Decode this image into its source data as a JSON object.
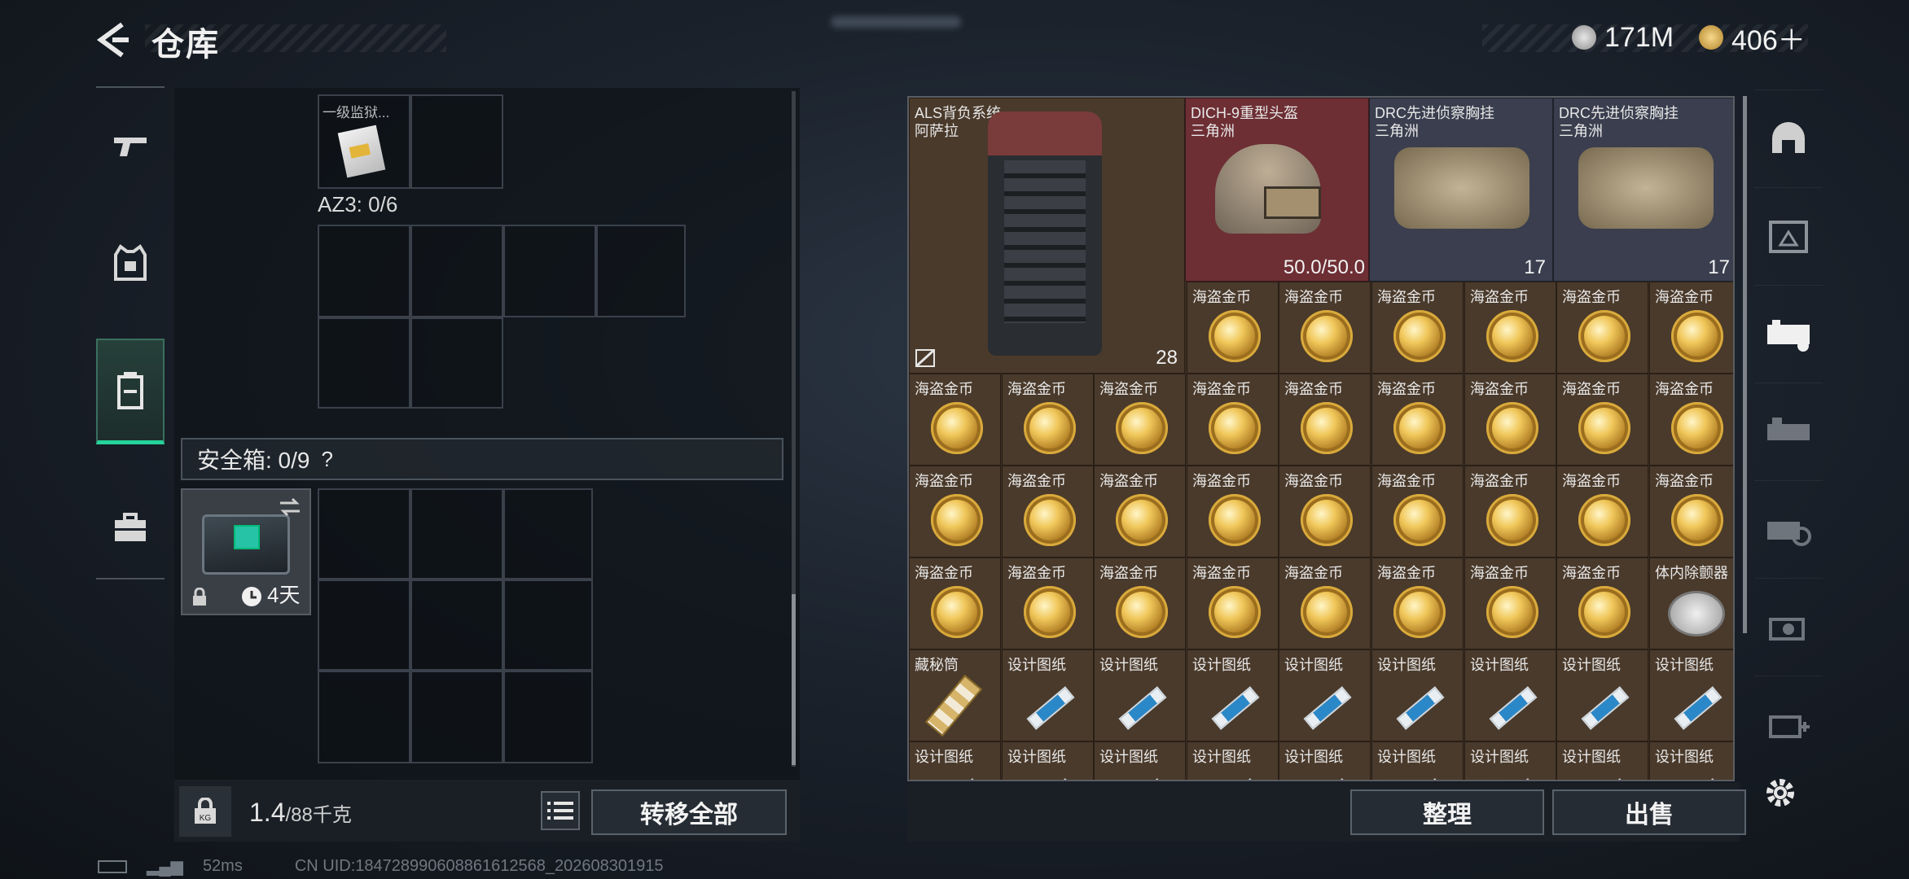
{
  "header": {
    "title": "仓库",
    "currency": [
      {
        "icon": "silver-coin-icon",
        "value": "171M"
      },
      {
        "icon": "gold-coin-icon",
        "value": "406＋"
      }
    ]
  },
  "left_tabs": [
    {
      "name": "weapon",
      "icon": "gun-icon"
    },
    {
      "name": "armor",
      "icon": "vest-icon"
    },
    {
      "name": "backpack",
      "icon": "backpack-icon",
      "active": true
    },
    {
      "name": "case",
      "icon": "briefcase-icon"
    }
  ],
  "left_panel": {
    "container_item_name": "一级监狱...",
    "az3_label": "AZ3: 0/6",
    "safe_box": {
      "label": "安全箱: 0/9",
      "help": "?",
      "duration": "4天"
    },
    "weight": {
      "current": "1.4",
      "max": "/88",
      "unit": "千克"
    },
    "transfer_all": "转移全部"
  },
  "grid": {
    "backpack": {
      "name": "ALS背负系统",
      "sub": "阿萨拉",
      "count": "28"
    },
    "helmet": {
      "name": "DICH-9重型头盔",
      "sub": "三角洲",
      "durability": "50.0/50.0"
    },
    "vests": [
      {
        "name": "DRC先进侦察胸挂",
        "sub": "三角洲",
        "count": "17"
      },
      {
        "name": "DRC先进侦察胸挂",
        "sub": "三角洲",
        "count": "17"
      }
    ],
    "gold_coin_name": "海盗金币",
    "detector_name": "体内除颤器",
    "hidden_tube_name": "藏秘筒",
    "blueprint_name": "设计图纸"
  },
  "buttons": {
    "sort": "整理",
    "sell": "出售"
  },
  "status": {
    "ping": "52ms",
    "uid": "CN UID:184728990608861612568_202608301915"
  },
  "right_tabs": [
    "helmet-slot",
    "rig-3",
    "rig-selected",
    "rig-2",
    "rig-4",
    "rig-5",
    "rig-6"
  ]
}
